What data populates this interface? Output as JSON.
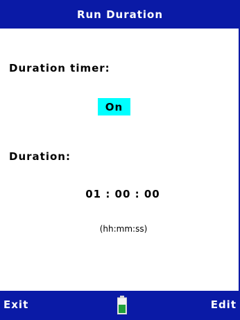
{
  "header": {
    "title": "Run Duration"
  },
  "timer": {
    "label": "Duration timer:",
    "value": "On"
  },
  "duration": {
    "label": "Duration:",
    "value": "01 : 00 : 00",
    "format_hint": "(hh:mm:ss)"
  },
  "softkeys": {
    "left": "Exit",
    "right": "Edit"
  },
  "battery": {
    "icon": "battery-icon",
    "level": 0.6
  },
  "colors": {
    "bar": "#0a1aa6",
    "highlight": "#00ffff",
    "battery_fill": "#1fa03a"
  }
}
